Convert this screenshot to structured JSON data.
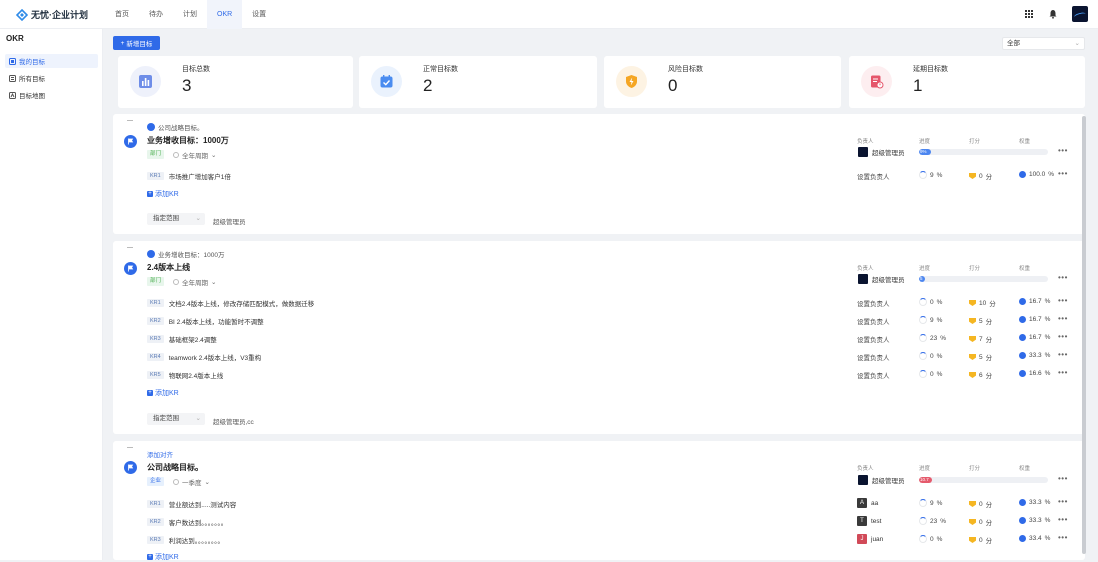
{
  "app": {
    "logo_text": "无忧·企业计划"
  },
  "nav": [
    {
      "label": "首页"
    },
    {
      "label": "待办"
    },
    {
      "label": "计划"
    },
    {
      "label": "OKR"
    },
    {
      "label": "设置"
    }
  ],
  "sidebar": {
    "title": "OKR",
    "items": [
      {
        "label": "我的目标"
      },
      {
        "label": "所有目标"
      },
      {
        "label": "目标地图"
      }
    ]
  },
  "toolbar": {
    "add_label": "新增目标",
    "filter_value": "全部"
  },
  "stats": [
    {
      "label": "目标总数",
      "value": "3",
      "color": "#6e8de8"
    },
    {
      "label": "正常目标数",
      "value": "2",
      "color": "#4a8cf0"
    },
    {
      "label": "风险目标数",
      "value": "0",
      "color": "#f5a623"
    },
    {
      "label": "延期目标数",
      "value": "1",
      "color": "#e5566b"
    }
  ],
  "columns": {
    "owner": "负责人",
    "progress": "进度",
    "score": "打分",
    "weight": "权重"
  },
  "common": {
    "set_owner": "设置负责人",
    "add_kr": "添加KR",
    "scope_label": "指定范围",
    "pct": "%",
    "score_unit": "分"
  },
  "objectives": [
    {
      "parent": "公司战略目标。",
      "title": "业务增收目标：1000万",
      "tag": "部门",
      "period": "全年周期",
      "owner": "超级管理员",
      "progress": 9,
      "progress_label": "9%",
      "krs": [
        {
          "code": "KR1",
          "text": "市场推广增加客户1倍",
          "owner": "设置负责人",
          "progress": "9",
          "score": "0",
          "weight": "100.0"
        }
      ],
      "scope_value": "超级管理员"
    },
    {
      "parent": "业务增收目标：1000万",
      "title": "2.4版本上线",
      "tag": "部门",
      "period": "全年周期",
      "owner": "超级管理员",
      "progress": 5,
      "progress_label": "5",
      "krs": [
        {
          "code": "KR1",
          "text": "文档2.4版本上线，修改存储匹配模式，做数据迁移",
          "owner": "设置负责人",
          "progress": "0",
          "score": "10",
          "weight": "16.7"
        },
        {
          "code": "KR2",
          "text": "BI 2.4版本上线，功能暂时不调整",
          "owner": "设置负责人",
          "progress": "9",
          "score": "5",
          "weight": "16.7"
        },
        {
          "code": "KR3",
          "text": "基础框架2.4调整",
          "owner": "设置负责人",
          "progress": "23",
          "score": "7",
          "weight": "16.7"
        },
        {
          "code": "KR4",
          "text": "teamwork 2.4版本上线，V3重构",
          "owner": "设置负责人",
          "progress": "0",
          "score": "5",
          "weight": "33.3"
        },
        {
          "code": "KR5",
          "text": "物联网2.4版本上线",
          "owner": "设置负责人",
          "progress": "0",
          "score": "6",
          "weight": "16.6"
        }
      ],
      "scope_value": "超级管理员,cc"
    },
    {
      "parent": "添加对齐",
      "title": "公司战略目标。",
      "tag": "企业",
      "period": "一季度",
      "owner": "超级管理员",
      "progress": 10,
      "progress_label": "10.7",
      "krs": [
        {
          "code": "KR1",
          "text": "营业额达到.....测试内容",
          "owner": "aa",
          "owner_initial": "A",
          "progress": "9",
          "score": "0",
          "weight": "33.3"
        },
        {
          "code": "KR2",
          "text": "客户数达到。。。。。。。",
          "owner": "test",
          "owner_initial": "T",
          "progress": "23",
          "score": "0",
          "weight": "33.3"
        },
        {
          "code": "KR3",
          "text": "利润达到。。。。。。。。",
          "owner": "juan",
          "owner_initial": "J",
          "progress": "0",
          "score": "0",
          "weight": "33.4"
        }
      ]
    }
  ]
}
